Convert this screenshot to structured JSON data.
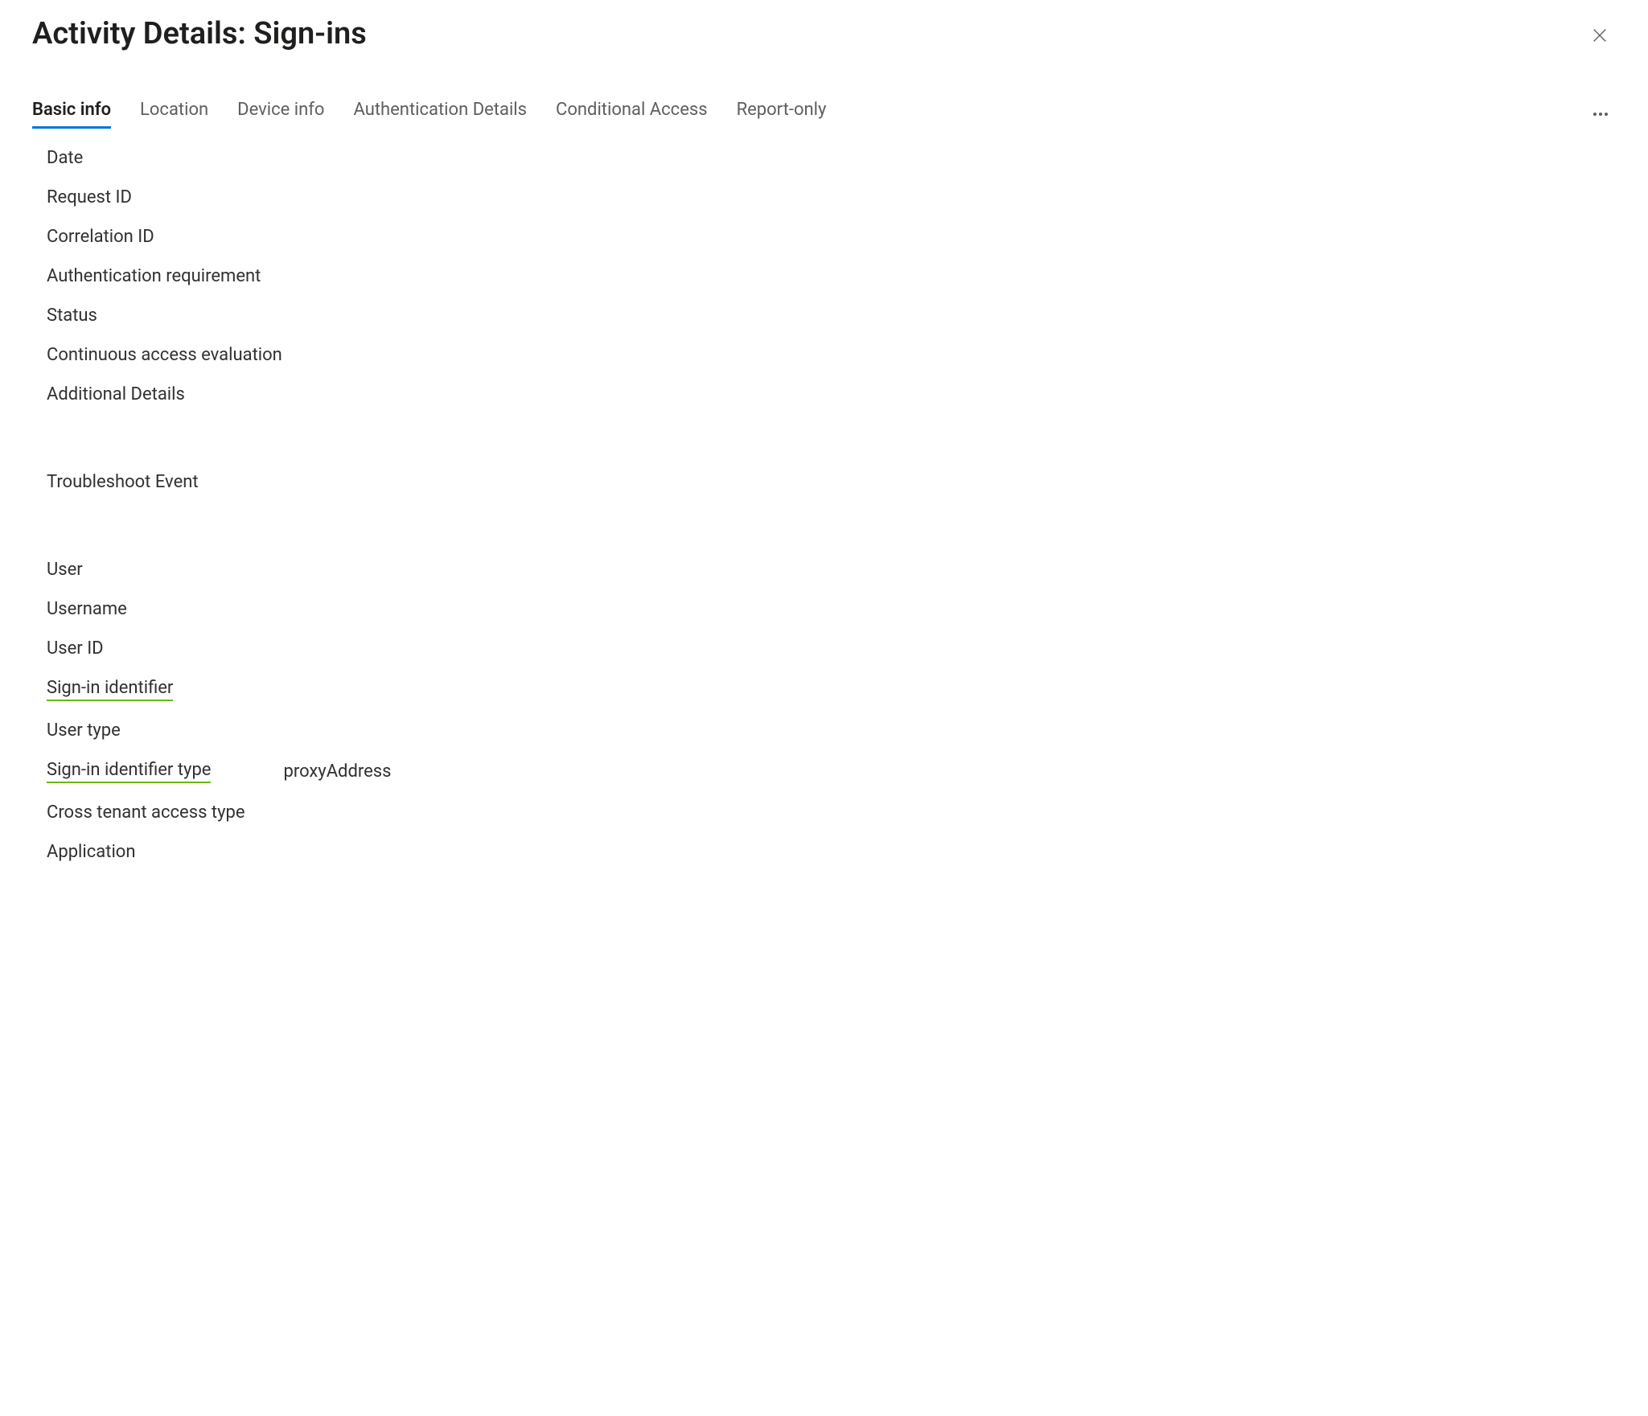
{
  "title": "Activity Details: Sign-ins",
  "tabs": [
    {
      "label": "Basic info",
      "active": true
    },
    {
      "label": "Location",
      "active": false
    },
    {
      "label": "Device info",
      "active": false
    },
    {
      "label": "Authentication Details",
      "active": false
    },
    {
      "label": "Conditional Access",
      "active": false
    },
    {
      "label": "Report-only",
      "active": false
    }
  ],
  "fields_group1": [
    {
      "label": "Date",
      "value": ""
    },
    {
      "label": "Request ID",
      "value": ""
    },
    {
      "label": "Correlation ID",
      "value": ""
    },
    {
      "label": "Authentication requirement",
      "value": ""
    },
    {
      "label": "Status",
      "value": ""
    },
    {
      "label": "Continuous access evaluation",
      "value": ""
    },
    {
      "label": "Additional Details",
      "value": ""
    }
  ],
  "fields_group2": [
    {
      "label": "Troubleshoot Event",
      "value": ""
    }
  ],
  "fields_group3": [
    {
      "label": "User",
      "value": "",
      "underlined": false
    },
    {
      "label": "Username",
      "value": "",
      "underlined": false
    },
    {
      "label": "User ID",
      "value": "",
      "underlined": false
    },
    {
      "label": "Sign-in identifier",
      "value": "",
      "underlined": true
    },
    {
      "label": "User type",
      "value": "",
      "underlined": false
    },
    {
      "label": "Sign-in identifier type",
      "value": "proxyAddress",
      "underlined": true
    },
    {
      "label": "Cross tenant access type",
      "value": "",
      "underlined": false
    },
    {
      "label": "Application",
      "value": "",
      "underlined": false
    }
  ]
}
